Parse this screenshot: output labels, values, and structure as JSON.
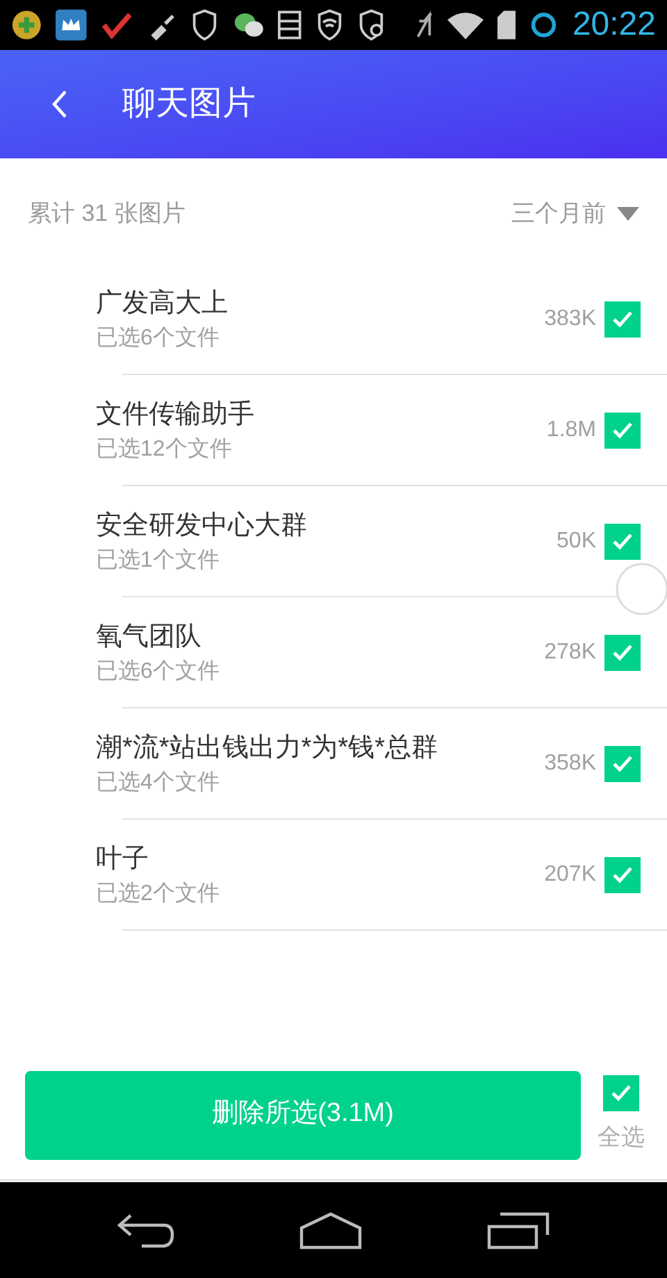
{
  "status_bar": {
    "time": "20:22"
  },
  "header": {
    "title": "聊天图片"
  },
  "summary": {
    "count_text": "累计 31 张图片",
    "filter": "三个月前"
  },
  "chats": [
    {
      "name": "广发高大上",
      "detail": "已选6个文件",
      "size": "383K",
      "checked": true
    },
    {
      "name": "文件传输助手",
      "detail": "已选12个文件",
      "size": "1.8M",
      "checked": true
    },
    {
      "name": "安全研发中心大群",
      "detail": "已选1个文件",
      "size": "50K",
      "checked": true
    },
    {
      "name": "氧气团队",
      "detail": "已选6个文件",
      "size": "278K",
      "checked": true
    },
    {
      "name": "潮*流*站出钱出力*为*钱*总群",
      "detail": "已选4个文件",
      "size": "358K",
      "checked": true
    },
    {
      "name": "叶子",
      "detail": "已选2个文件",
      "size": "207K",
      "checked": true
    }
  ],
  "footer": {
    "delete_button": "删除所选(3.1M)",
    "select_all": {
      "label": "全选",
      "checked": true
    }
  }
}
